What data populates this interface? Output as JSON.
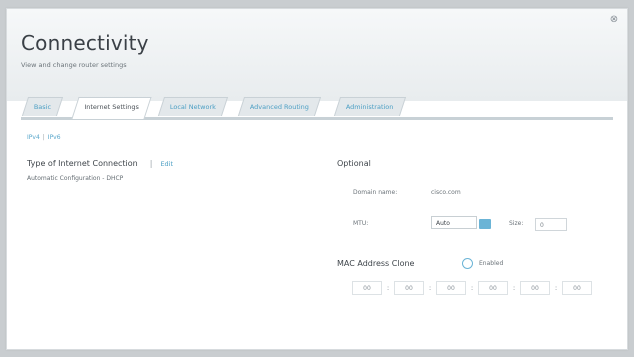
{
  "header": {
    "title": "Connectivity",
    "subtitle": "View and change router settings",
    "close_glyph": "⊗"
  },
  "tabs": [
    {
      "label": "Basic",
      "active": false
    },
    {
      "label": "Internet Settings",
      "active": true
    },
    {
      "label": "Local Network",
      "active": false
    },
    {
      "label": "Advanced Routing",
      "active": false
    },
    {
      "label": "Administration",
      "active": false
    }
  ],
  "breadcrumb": {
    "ipv4": "IPv4",
    "sep": "|",
    "ipv6": "IPv6"
  },
  "internet": {
    "title": "Type of Internet Connection",
    "sep": "|",
    "edit": "Edit",
    "value": "Automatic Configuration - DHCP"
  },
  "optional": {
    "title": "Optional",
    "domain_label": "Domain name:",
    "domain_value": "cisco.com",
    "mtu_label": "MTU:",
    "mtu_selected": "Auto",
    "size_label": "Size:",
    "size_value": "0"
  },
  "mac_clone": {
    "title": "MAC Address Clone",
    "enabled_label": "Enabled",
    "octets": [
      "00",
      "00",
      "00",
      "00",
      "00",
      "00"
    ],
    "colon": ":"
  },
  "colors": {
    "accent": "#4c9fc4",
    "select_button": "#6bb4d6"
  }
}
